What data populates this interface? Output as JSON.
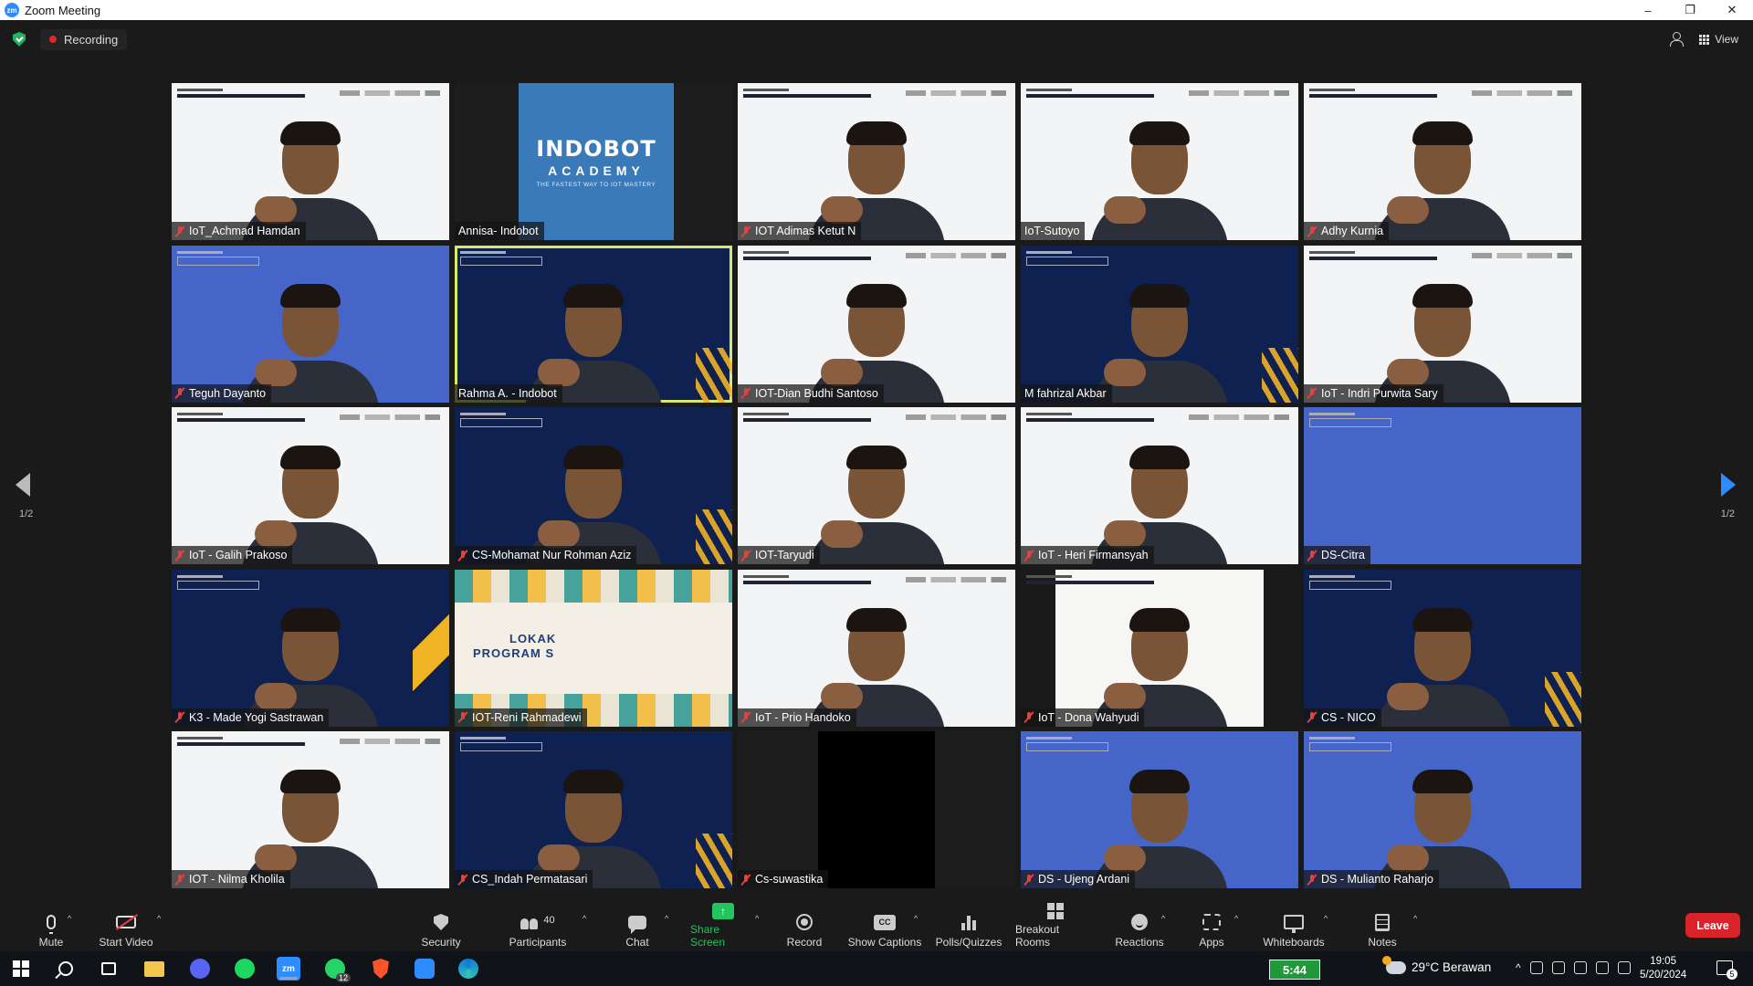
{
  "window": {
    "title": "Zoom Meeting",
    "logo_text": "zm",
    "minimize_glyph": "–",
    "restore_glyph": "❐",
    "close_glyph": "✕"
  },
  "top_bar": {
    "recording_label": "Recording",
    "view_label": "View"
  },
  "participants": [
    {
      "name": "IoT_Achmad Hamdan",
      "style": "light",
      "muted": true
    },
    {
      "name": "Annisa- Indobot",
      "style": "indobot",
      "muted": false,
      "card": {
        "line1": "INDOBOT",
        "line2": "ACADEMY",
        "line3": "THE FASTEST WAY TO IOT MASTERY"
      }
    },
    {
      "name": "IOT Adimas Ketut N",
      "style": "light",
      "muted": true
    },
    {
      "name": "IoT-Sutoyo",
      "style": "light",
      "muted": false
    },
    {
      "name": "Adhy Kurnia",
      "style": "light",
      "muted": true
    },
    {
      "name": "Teguh Dayanto",
      "style": "blue",
      "muted": true
    },
    {
      "name": "Rahma A. - Indobot",
      "style": "dark",
      "muted": false,
      "active": true
    },
    {
      "name": "IOT-Dian Budhi Santoso",
      "style": "light",
      "muted": true
    },
    {
      "name": "M fahrizal Akbar",
      "style": "dark",
      "muted": false
    },
    {
      "name": "IoT - Indri Purwita Sary",
      "style": "light",
      "muted": true
    },
    {
      "name": "IoT - Galih Prakoso",
      "style": "light",
      "muted": true
    },
    {
      "name": "CS-Mohamat Nur Rohman Aziz",
      "style": "dark",
      "muted": true
    },
    {
      "name": "IOT-Taryudi",
      "style": "light",
      "muted": true
    },
    {
      "name": "IoT - Heri Firmansyah",
      "style": "light",
      "muted": true
    },
    {
      "name": "DS-Citra",
      "style": "blue",
      "muted": true,
      "no_person": true
    },
    {
      "name": "K3 - Made Yogi Sastrawan",
      "style": "dark",
      "muted": true
    },
    {
      "name": "IOT-Reni Rahmadewi",
      "style": "lokakarya",
      "muted": true,
      "banner": {
        "line1": "LOKAK",
        "line2": "PROGRAM S"
      }
    },
    {
      "name": "IoT - Prio Handoko",
      "style": "light",
      "muted": true
    },
    {
      "name": "IoT - Dona Wahyudi",
      "style": "whitecard",
      "muted": true
    },
    {
      "name": "CS - NICO",
      "style": "dark",
      "muted": true
    },
    {
      "name": "IOT - Nilma Kholila",
      "style": "light",
      "muted": true
    },
    {
      "name": "CS_Indah Permatasari",
      "style": "dark",
      "muted": true
    },
    {
      "name": "Cs-suwastika",
      "style": "black",
      "muted": true,
      "no_person": true
    },
    {
      "name": "DS - Ujeng Ardani",
      "style": "blue",
      "muted": true
    },
    {
      "name": "DS - Mulianto Raharjo",
      "style": "blue",
      "muted": true
    }
  ],
  "pagination": {
    "left": "1/2",
    "right": "1/2"
  },
  "toolbar": {
    "mute": "Mute",
    "start_video": "Start Video",
    "security": "Security",
    "participants": "Participants",
    "participants_count": "40",
    "chat": "Chat",
    "share_screen": "Share Screen",
    "record": "Record",
    "show_captions": "Show Captions",
    "cc_glyph": "CC",
    "polls": "Polls/Quizzes",
    "breakout": "Breakout Rooms",
    "reactions": "Reactions",
    "apps": "Apps",
    "whiteboards": "Whiteboards",
    "notes": "Notes",
    "leave": "Leave",
    "caret": "^",
    "share_glyph": "↑"
  },
  "taskbar": {
    "zoom_label": "zm",
    "whatsapp_badge": "12",
    "battery_time": "5:44",
    "weather": "29°C  Berawan",
    "time": "19:05",
    "date": "5/20/2024",
    "notifications": "5"
  },
  "colors": {
    "accent_blue": "#2d8cff",
    "share_green": "#22c55e",
    "leave_red": "#d9222a",
    "muted_red": "#e5413f",
    "active_speaker": "#d7e86f"
  }
}
